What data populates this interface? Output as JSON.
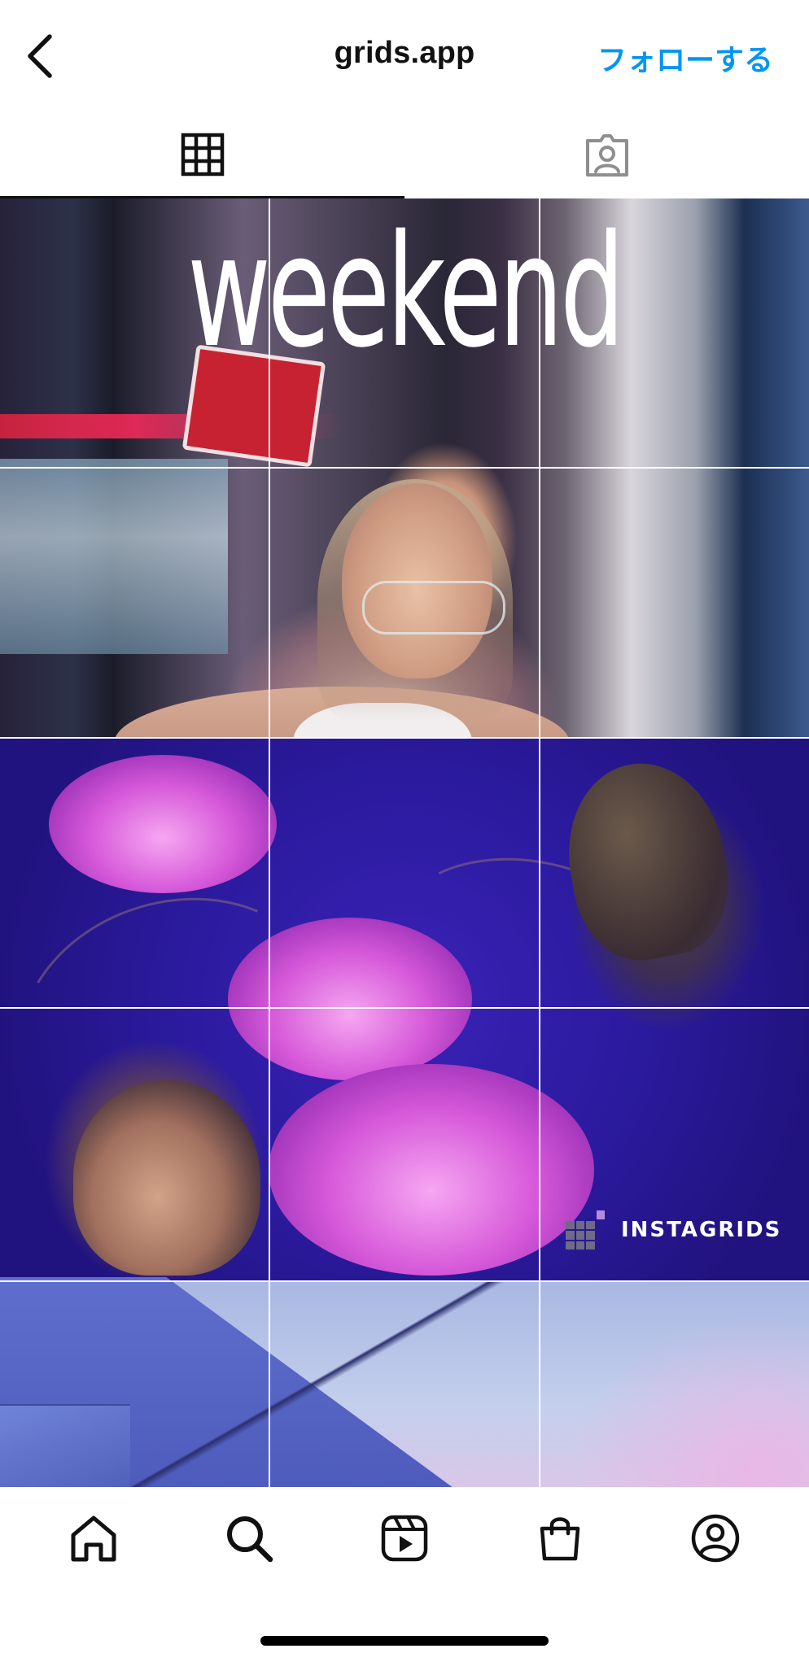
{
  "header": {
    "back_icon": "chevron-left-icon",
    "title": "grids.app",
    "follow_label": "フォローする",
    "accent_color": "#0095f6"
  },
  "tabs": [
    {
      "icon": "grid-icon",
      "active": true
    },
    {
      "icon": "tagged-person-icon",
      "active": false
    }
  ],
  "grid": {
    "columns": 3,
    "rows_visible": 5,
    "overlay_text": "weekend",
    "brand_text": "INSTAGRIDS"
  },
  "bottom_nav": [
    {
      "icon": "home-icon"
    },
    {
      "icon": "search-icon"
    },
    {
      "icon": "reels-icon"
    },
    {
      "icon": "shop-icon"
    },
    {
      "icon": "profile-icon"
    }
  ]
}
